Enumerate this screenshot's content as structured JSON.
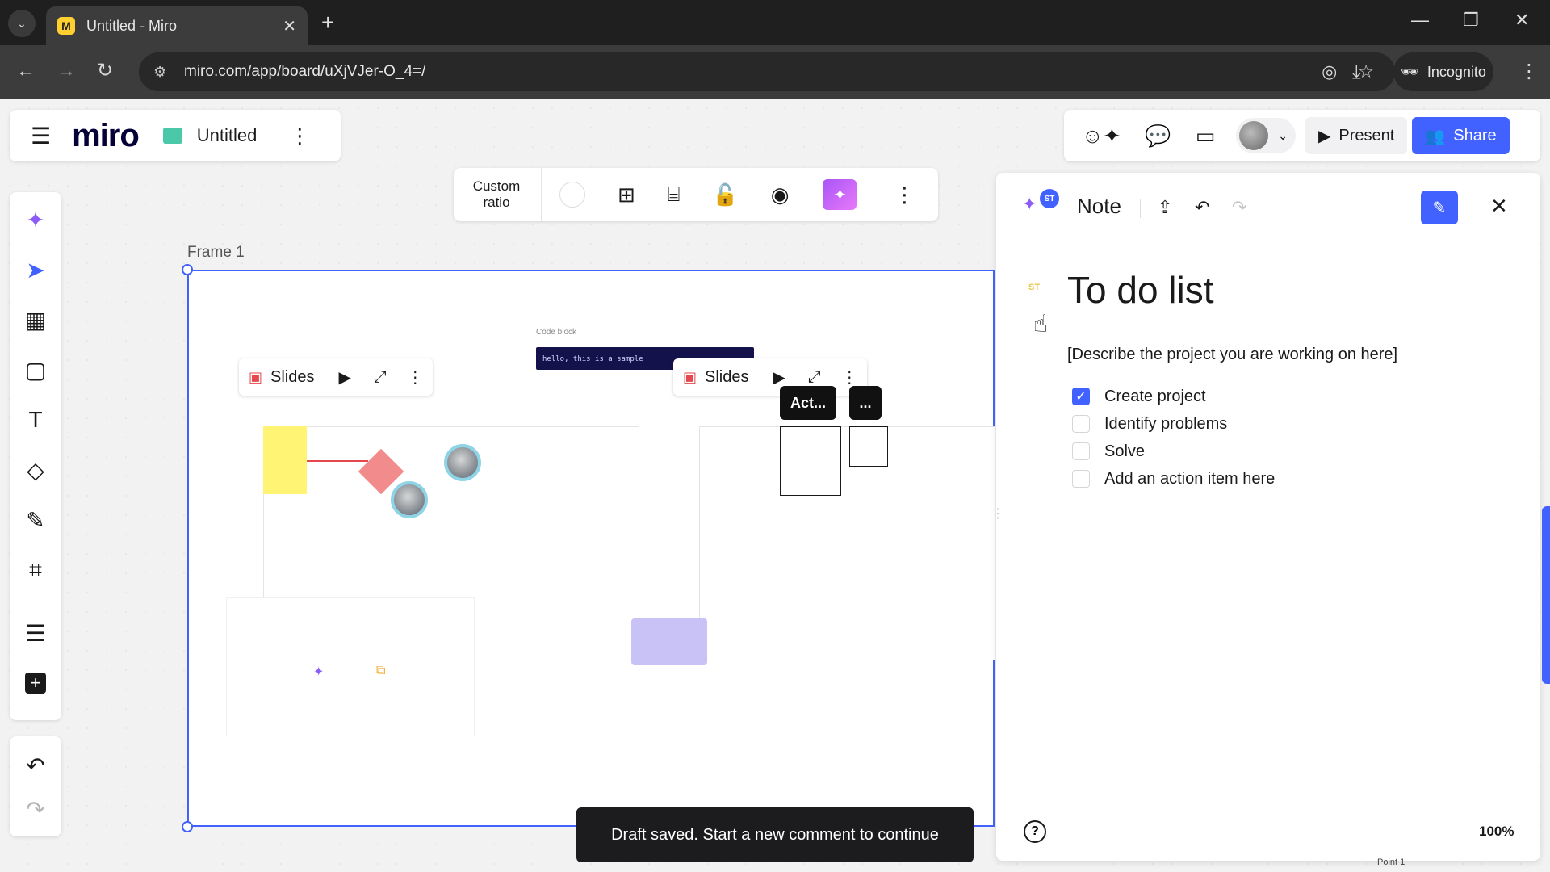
{
  "browser": {
    "tab_title": "Untitled - Miro",
    "url": "miro.com/app/board/uXjVJer-O_4=/",
    "incognito_label": "Incognito"
  },
  "header": {
    "logo": "miro",
    "board_name": "Untitled",
    "present_label": "Present",
    "share_label": "Share"
  },
  "frame_toolbar": {
    "ratio_label": "Custom\nratio"
  },
  "canvas": {
    "frame_label": "Frame 1",
    "slides_label_1": "Slides",
    "slides_label_2": "Slides",
    "code_block_label": "Code block",
    "code_block_text": "hello, this is a sample",
    "act_chip": "Act...",
    "more_chip": "..."
  },
  "toast": {
    "message": "Draft saved. Start a new comment to continue"
  },
  "note_panel": {
    "title": "Note",
    "badge": "ST",
    "doc_badge": "ST",
    "doc_title": "To do list",
    "description": "[Describe the project you are working on here]",
    "items": [
      {
        "label": "Create project",
        "checked": true
      },
      {
        "label": "Identify problems",
        "checked": false
      },
      {
        "label": "Solve",
        "checked": false
      },
      {
        "label": "Add an action item here",
        "checked": false
      }
    ],
    "zoom": "100%"
  },
  "misc": {
    "point_label": "Point 1"
  },
  "colors": {
    "accent": "#4262ff",
    "ai_purple": "#8b5cf6",
    "sticky_yellow": "#fff474",
    "code_block_bg": "#14124b"
  }
}
